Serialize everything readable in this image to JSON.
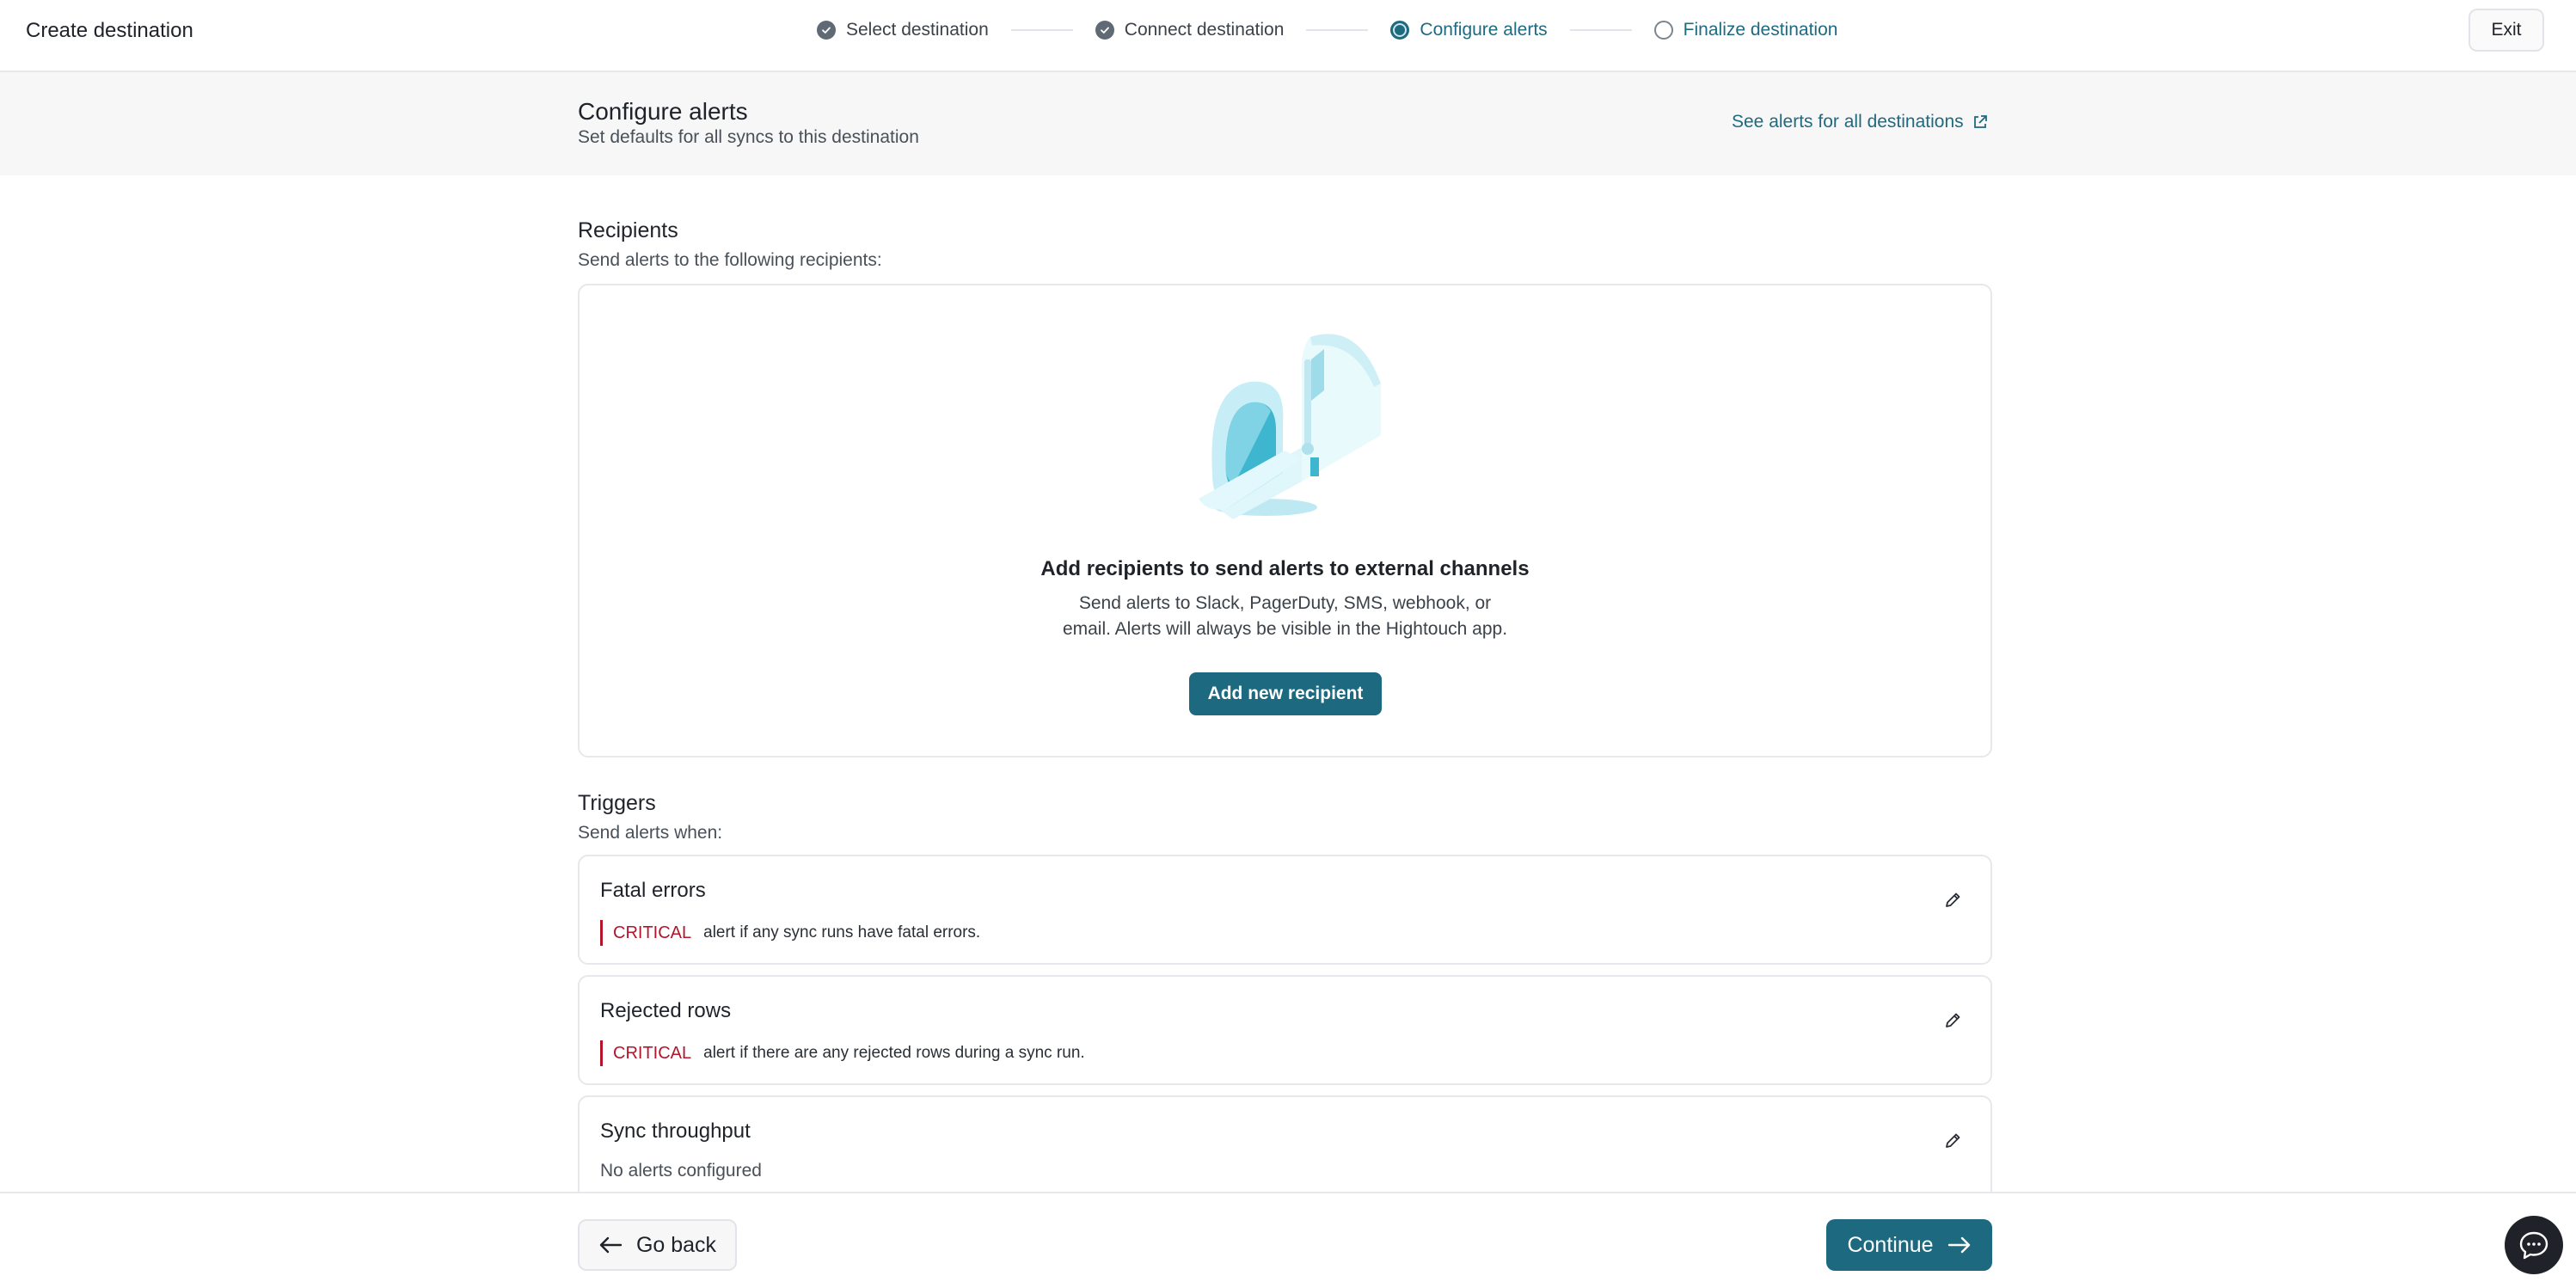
{
  "header": {
    "app_title": "Create destination",
    "exit_label": "Exit"
  },
  "steps": [
    {
      "label": "Select destination",
      "state": "done"
    },
    {
      "label": "Connect destination",
      "state": "done"
    },
    {
      "label": "Configure alerts",
      "state": "active"
    },
    {
      "label": "Finalize destination",
      "state": "pending"
    }
  ],
  "page": {
    "title": "Configure alerts",
    "subtitle": "Set defaults for all syncs to this destination",
    "see_alerts_link": "See alerts for all destinations"
  },
  "recipients": {
    "title": "Recipients",
    "subtitle": "Send alerts to the following recipients:",
    "empty_title": "Add recipients to send alerts to external channels",
    "empty_line1": "Send alerts to Slack, PagerDuty, SMS, webhook, or",
    "empty_line2": "email. Alerts will always be visible in the Hightouch app.",
    "add_button": "Add new recipient",
    "illustration_icon": "mailbox-illustration"
  },
  "triggers": {
    "title": "Triggers",
    "subtitle": "Send alerts when:",
    "items": [
      {
        "name": "Fatal errors",
        "severity": "CRITICAL",
        "description": "alert if any sync runs have fatal errors."
      },
      {
        "name": "Rejected rows",
        "severity": "CRITICAL",
        "description": "alert if there are any rejected rows during a sync run."
      },
      {
        "name": "Sync throughput",
        "status": "No alerts configured"
      }
    ]
  },
  "footer": {
    "back_label": "Go back",
    "continue_label": "Continue"
  },
  "colors": {
    "accent": "#1d6a80",
    "critical": "#b3162c",
    "header_band": "#f7f7f8"
  }
}
